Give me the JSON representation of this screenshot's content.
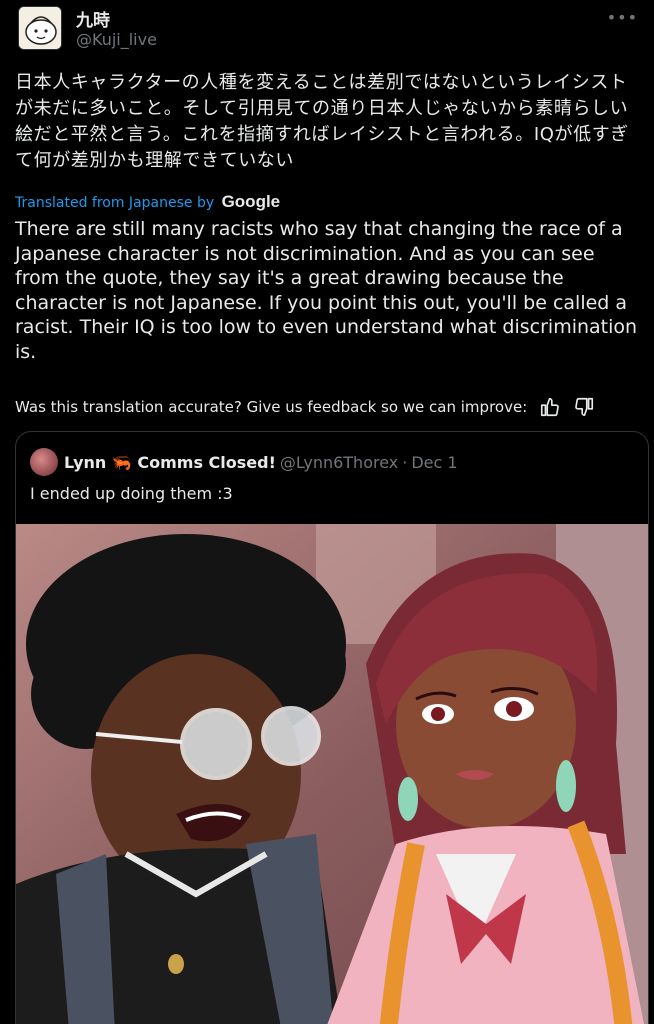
{
  "tweet": {
    "display_name": "九時",
    "handle": "@Kuji_live",
    "more_icon": "more-dots-icon",
    "original_text": "日本人キャラクターの人種を変えることは差別ではないというレイシストが未だに多いこと。そして引用見ての通り日本人じゃないから素晴らしい絵だと平然と言う。これを指摘すればレイシストと言われる。IQが低すぎて何が差別かも理解できていない",
    "translated_label": "Translated from Japanese by",
    "translator_brand": "Google",
    "translated_text": "There are still many racists who say that changing the race of a Japanese character is not discrimination. And as you can see from the quote, they say it's a great drawing because the character is not Japanese. If you point this out, you'll be called a racist. Their IQ is too low to even understand what discrimination is.",
    "feedback_prompt": "Was this translation accurate? Give us feedback so we can improve:",
    "feedback_icons": [
      "thumbs-up-icon",
      "thumbs-down-icon"
    ]
  },
  "quoted_tweet": {
    "author_name": "Lynn 🦐 Comms Closed!",
    "author_handle": "@Lynn6Thorex",
    "separator": "·",
    "date": "Dec 1",
    "text": "I ended up doing them :3",
    "image_description": "illustration-two-characters"
  },
  "colors": {
    "background": "#000000",
    "text_primary": "#e7e9ea",
    "text_secondary": "#71767b",
    "link_blue": "#1d9bf0",
    "border": "#2f3336"
  }
}
